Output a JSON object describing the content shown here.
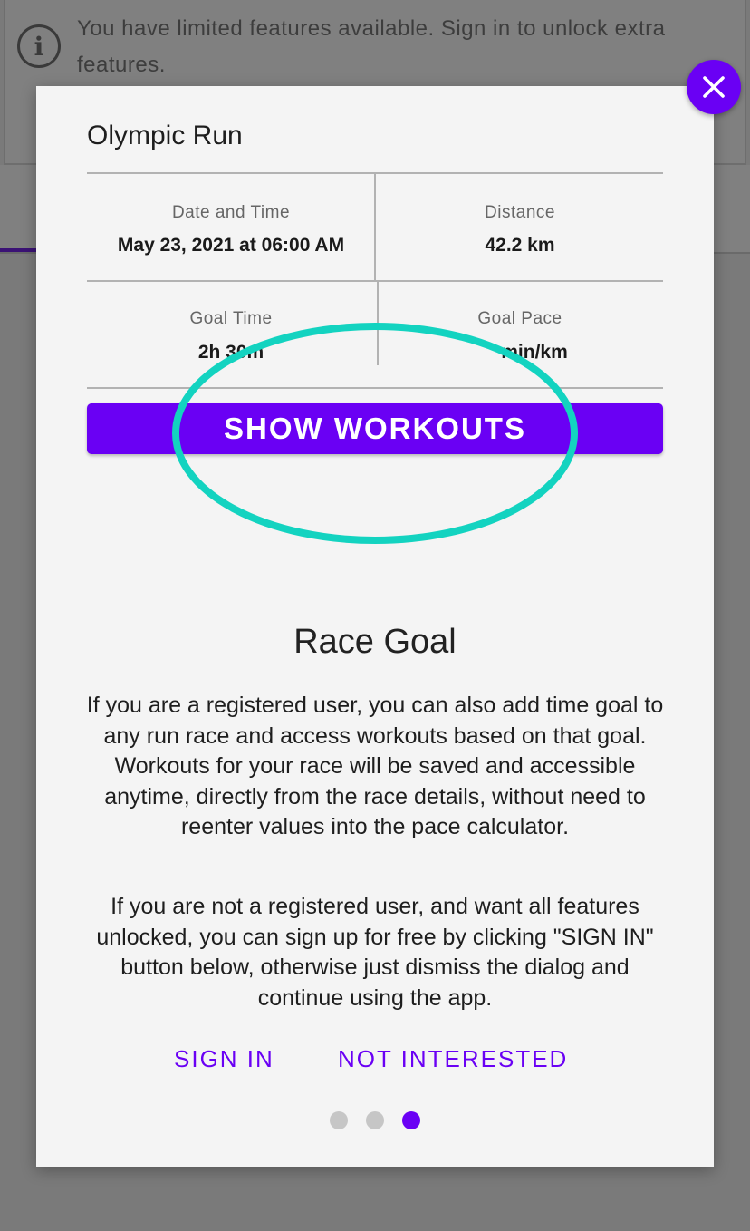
{
  "banner": {
    "icon": "info-icon",
    "text": "You have limited features available. Sign in to unlock extra features."
  },
  "dialog": {
    "preview": {
      "title": "Olympic Run",
      "cells": [
        {
          "label": "Date and Time",
          "value": "May 23, 2021 at 06:00 AM"
        },
        {
          "label": "Distance",
          "value": "42.2 km"
        },
        {
          "label": "Goal Time",
          "value": "2h 30m"
        },
        {
          "label": "Goal Pace",
          "value": "min/km"
        }
      ],
      "button_label": "SHOW WORKOUTS",
      "highlight_color": "#13d3c0"
    },
    "title": "Race Goal",
    "paragraphs": [
      "If you are a registered user, you can also add time goal to any run race and access workouts based on that goal. Workouts for your race will be saved and accessible anytime, directly from the race details, without need to reenter values into the pace calculator.",
      "If you are not a registered user, and want all features unlocked, you can sign up for free by clicking \"SIGN IN\" button below, otherwise just dismiss the dialog and continue using the app."
    ],
    "actions": {
      "sign_in": "SIGN IN",
      "dismiss": "NOT INTERESTED"
    },
    "pager": {
      "count": 3,
      "active_index": 2
    },
    "close_icon": "close-icon"
  },
  "colors": {
    "accent": "#6a00f4",
    "highlight": "#13d3c0",
    "dot_inactive": "#c6c6c6"
  }
}
